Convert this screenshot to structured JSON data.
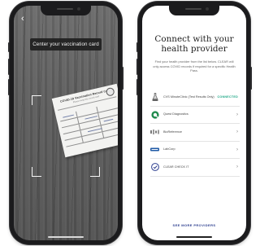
{
  "scan_screen": {
    "back_label": "‹",
    "banner_text": "Center your vaccination card",
    "card": {
      "title": "COVID-19 Vaccination Record Card",
      "subtitle": "Please keep this record card"
    }
  },
  "connect_screen": {
    "title_line1": "Connect with your",
    "title_line2": "health provider",
    "description": "Find your health provider from the list below. CLEAR will only access COVID records if required for a specific Health Pass.",
    "providers": [
      {
        "name": "CVS MinuteClinic (Test Results Only)",
        "status": "CONNECTED",
        "icon": "flask-icon"
      },
      {
        "name": "Quest Diagnostics",
        "status": "",
        "icon": "quest-logo"
      },
      {
        "name": "BioReference",
        "status": "",
        "icon": "bioreference-logo"
      },
      {
        "name": "LabCorp",
        "status": "",
        "icon": "labcorp-logo"
      },
      {
        "name": "CLEAR CHECK IT",
        "status": "",
        "icon": "clear-logo"
      }
    ],
    "see_more_label": "SEE MORE PROVIDERS",
    "colors": {
      "connected": "#18a583",
      "link": "#2c3e8f"
    }
  }
}
